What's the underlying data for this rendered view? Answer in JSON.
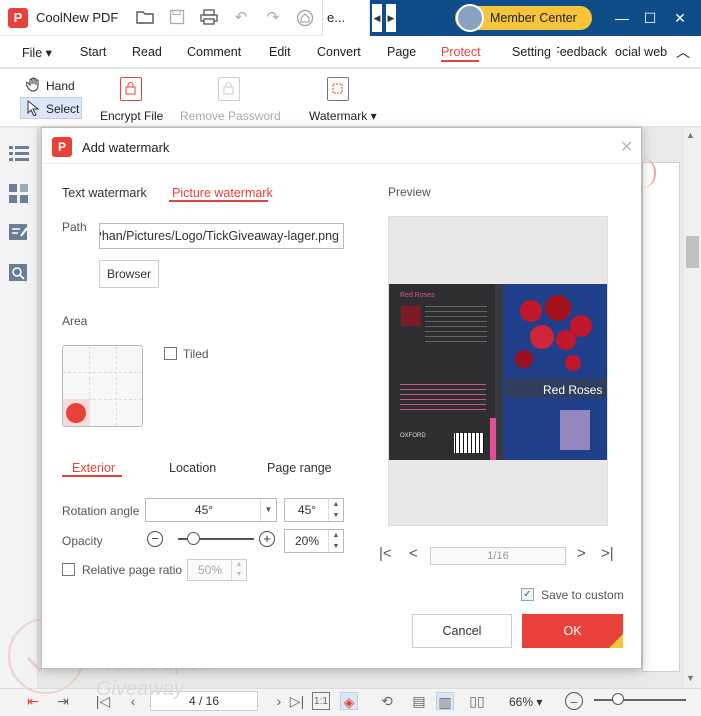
{
  "app": {
    "title": "CoolNew PDF",
    "doc_tab": "e..."
  },
  "member": {
    "label": "Member Center"
  },
  "menu": {
    "file": "File",
    "start": "Start",
    "read": "Read",
    "comment": "Comment",
    "edit": "Edit",
    "convert": "Convert",
    "page": "Page",
    "protect": "Protect",
    "setting": "Setting",
    "feedback": "Feedback",
    "social": "ocial web"
  },
  "ribbon": {
    "hand": "Hand",
    "select": "Select",
    "encrypt": "Encrypt File",
    "remove_password": "Remove Password",
    "watermark": "Watermark"
  },
  "dialog": {
    "title": "Add watermark",
    "tabs": {
      "text": "Text watermark",
      "picture": "Picture watermark"
    },
    "path_label": "Path",
    "path_value": "C:/Users/ThanhPhan/Pictures/Logo/TickGiveaway-lager.png",
    "browser": "Browser",
    "area_label": "Area",
    "tiled": "Tiled",
    "subtabs": {
      "exterior": "Exterior",
      "location": "Location",
      "page_range": "Page range"
    },
    "rotation_label": "Rotation angle",
    "rotation_select": "45°",
    "rotation_spin": "45°",
    "opacity_label": "Opacity",
    "opacity_value": "20%",
    "opacity_level": 0.2,
    "relative_label": "Relative page ratio",
    "relative_value": "50%",
    "preview_label": "Preview",
    "preview_page": "1/16",
    "save_custom": "Save to custom",
    "cancel": "Cancel",
    "ok": "OK"
  },
  "preview_cover": {
    "title_back": "Red Roses",
    "title_front": "Red Roses",
    "publisher": "OXFORD"
  },
  "status": {
    "page": "4 / 16",
    "zoom": "66%",
    "zoom_level": 0.26
  },
  "watermark_overlay": {
    "line1": "Tickcoupon",
    "line2": "Giveaway"
  },
  "colors": {
    "accent": "#e8413a",
    "member_pill": "#f6c53a",
    "title_bar_dark": "#0f4c8a"
  }
}
